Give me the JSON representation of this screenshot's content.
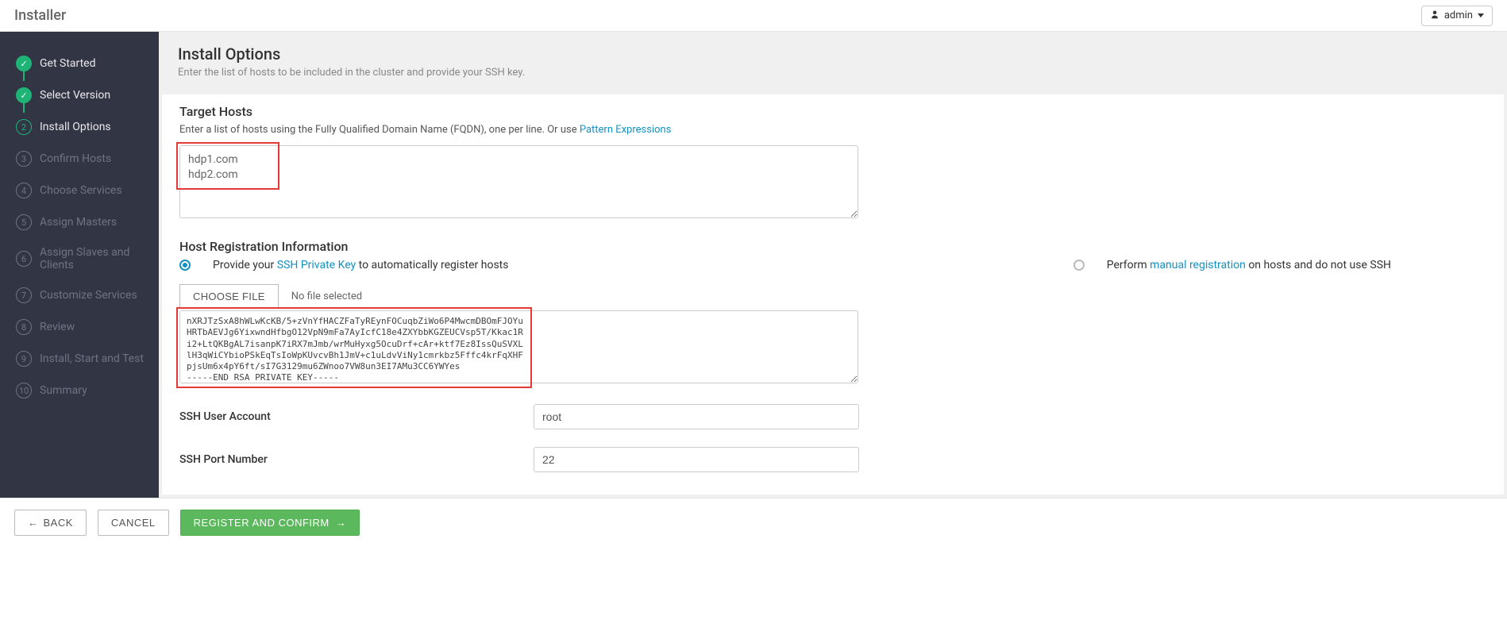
{
  "app_title": "Installer",
  "user": "admin",
  "sidebar": {
    "steps": [
      {
        "label": "Get Started",
        "state": "done"
      },
      {
        "label": "Select Version",
        "state": "done"
      },
      {
        "label": "Install Options",
        "state": "active",
        "num": "2"
      },
      {
        "label": "Confirm Hosts",
        "state": "pending",
        "num": "3"
      },
      {
        "label": "Choose Services",
        "state": "pending",
        "num": "4"
      },
      {
        "label": "Assign Masters",
        "state": "pending",
        "num": "5"
      },
      {
        "label": "Assign Slaves and Clients",
        "state": "pending",
        "num": "6"
      },
      {
        "label": "Customize Services",
        "state": "pending",
        "num": "7"
      },
      {
        "label": "Review",
        "state": "pending",
        "num": "8"
      },
      {
        "label": "Install, Start and Test",
        "state": "pending",
        "num": "9"
      },
      {
        "label": "Summary",
        "state": "pending",
        "num": "10"
      }
    ]
  },
  "header": {
    "title": "Install Options",
    "subtitle": "Enter the list of hosts to be included in the cluster and provide your SSH key."
  },
  "target_hosts": {
    "title": "Target Hosts",
    "desc_pre": "Enter a list of hosts using the Fully Qualified Domain Name (FQDN), one per line. Or use ",
    "desc_link": "Pattern Expressions",
    "value": "hdp1.com\nhdp2.com"
  },
  "host_reg": {
    "title": "Host Registration Information",
    "opt1_pre": "Provide your ",
    "opt1_link": "SSH Private Key",
    "opt1_post": " to automatically register hosts",
    "opt2_pre": "Perform ",
    "opt2_link": "manual registration",
    "opt2_post": " on hosts and do not use SSH",
    "choose_file": "CHOOSE FILE",
    "file_status": "No file selected",
    "key_value": "nXRJTzSxA8hWLwKcKB/5+zVnYfHACZFaTyREynFOCuqbZiWo6P4MwcmDBOmFJOYu\nHRTbAEVJg6YixwndHfbgO12VpN9mFa7AyIcfC18e4ZXYbbKGZEUCVsp5T/Kkac1R\ni2+LtQKBgAL7isanpK7iRX7mJmb/wrMuHyxg5OcuDrf+cAr+ktf7Ez8IssQuSVXL\nlH3qWiCYbioPSkEqTsIoWpKUvcvBh1JmV+c1uLdvViNy1cmrkbz5Fffc4krFqXHF\npjsUm6x4pY6ft/sI7G3129mu6ZWnoo7VW8un3EI7AMu3CC6YWYes\n-----END RSA PRIVATE KEY-----"
  },
  "ssh_user": {
    "label": "SSH User Account",
    "value": "root"
  },
  "ssh_port": {
    "label": "SSH Port Number",
    "value": "22"
  },
  "footer": {
    "back": "BACK",
    "cancel": "CANCEL",
    "confirm": "REGISTER AND CONFIRM"
  }
}
